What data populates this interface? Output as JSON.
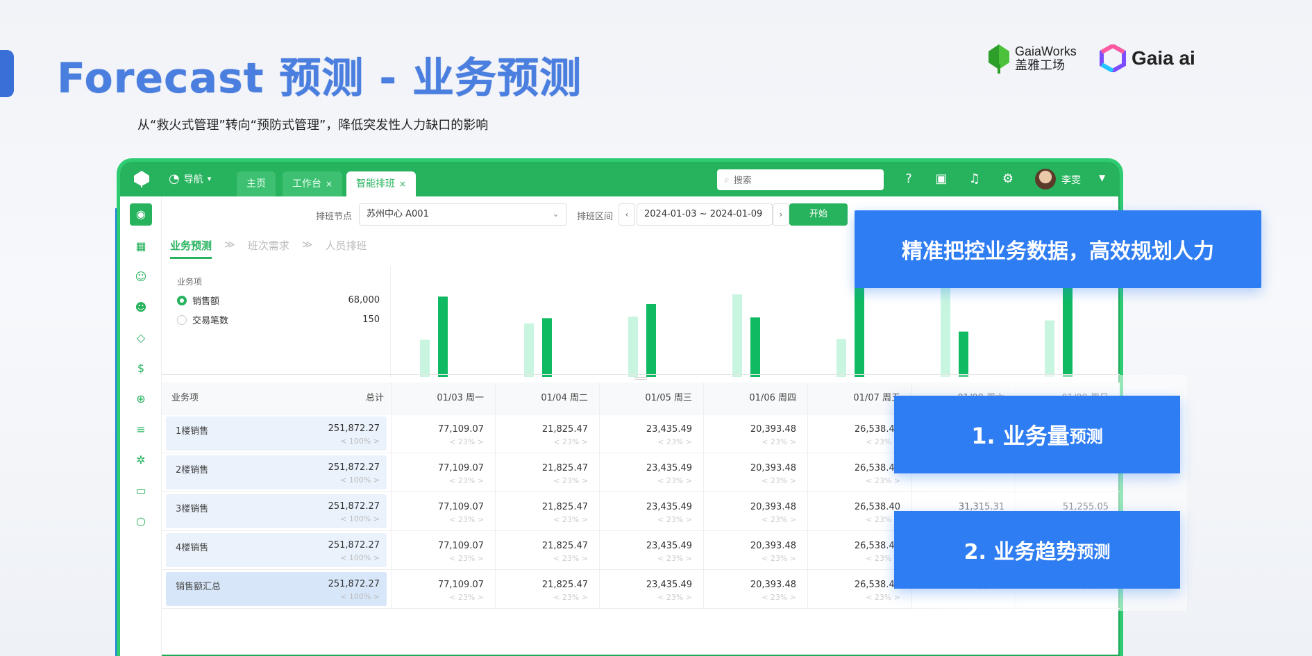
{
  "slide": {
    "title": "Forecast 预测 - 业务预测",
    "subtitle": "从“救火式管理”转向“预防式管理”，降低突发性人力缺口的影响"
  },
  "logos": {
    "gaiaworks_en": "GaiaWorks",
    "gaiaworks_cn": "盖雅工场",
    "gaiaai": "Gaia ai"
  },
  "colors": {
    "brand_green": "#27b35e",
    "callout_blue": "#2f7df2",
    "bar_light": "#c8f5e0",
    "bar_dark": "#0fba62"
  },
  "app": {
    "nav_label": "导航",
    "tabs": [
      {
        "label": "主页"
      },
      {
        "label": "工作台",
        "close": "×"
      },
      {
        "label": "智能排班",
        "close": "×"
      }
    ],
    "search_placeholder": "搜索",
    "username": "李雯",
    "filters": {
      "node_label": "排班节点",
      "node_value": "苏州中心 A001",
      "range_label": "排班区间",
      "range_value": "2024-01-03 ~ 2024-01-09",
      "start_button": "开始"
    },
    "subtabs": [
      "业务预测",
      "班次需求",
      "人员排班"
    ],
    "subtab_sep": "≫",
    "items_header": "业务项",
    "items": [
      {
        "name": "销售额",
        "value": "68,000",
        "selected": true
      },
      {
        "name": "交易笔数",
        "value": "150",
        "selected": false
      }
    ]
  },
  "chart_data": {
    "type": "bar",
    "categories": [
      "01/03 周一",
      "01/04 周二",
      "01/05 周三",
      "01/06 周四",
      "01/07 周五",
      "01/08 周六",
      "01/09 周日"
    ],
    "series": [
      {
        "values": [
          50,
          72,
          81,
          111,
          51,
          123,
          76
        ]
      },
      {
        "values": [
          108,
          79,
          98,
          80,
          127,
          61,
          121
        ]
      }
    ],
    "ylim": [
      0,
      140
    ]
  },
  "grid": {
    "header": {
      "item": "业务项",
      "total": "总计",
      "dates": [
        "01/03 周一",
        "01/04 周二",
        "01/05 周三",
        "01/06 周四",
        "01/07 周五",
        "01/08 周六",
        "01/09 周日"
      ]
    },
    "pct_label": "< 23% >",
    "total_pct_label": "< 100% >",
    "rows": [
      {
        "name": "1楼销售",
        "total": "251,872.27",
        "cells": [
          "77,109.07",
          "21,825.47",
          "23,435.49",
          "20,393.48",
          "26,538.40",
          "",
          ""
        ]
      },
      {
        "name": "2楼销售",
        "total": "251,872.27",
        "cells": [
          "77,109.07",
          "21,825.47",
          "23,435.49",
          "20,393.48",
          "26,538.40",
          "",
          ""
        ]
      },
      {
        "name": "3楼销售",
        "total": "251,872.27",
        "cells": [
          "77,109.07",
          "21,825.47",
          "23,435.49",
          "20,393.48",
          "26,538.40",
          "31,315.31",
          "51,255.05"
        ]
      },
      {
        "name": "4楼销售",
        "total": "251,872.27",
        "cells": [
          "77,109.07",
          "21,825.47",
          "23,435.49",
          "20,393.48",
          "26,538.40",
          "",
          ""
        ]
      },
      {
        "name": "销售额汇总",
        "total": "251,872.27",
        "cells": [
          "77,109.07",
          "21,825.47",
          "23,435.49",
          "20,393.48",
          "26,538.40",
          "",
          ""
        ],
        "summary": true
      }
    ]
  },
  "callouts": {
    "c1": "精准把控业务数据，高效规划人力",
    "c2_main": "1. 业务量",
    "c2_small": "预测",
    "c3_main": "2. 业务趋势",
    "c3_small": "预测"
  }
}
